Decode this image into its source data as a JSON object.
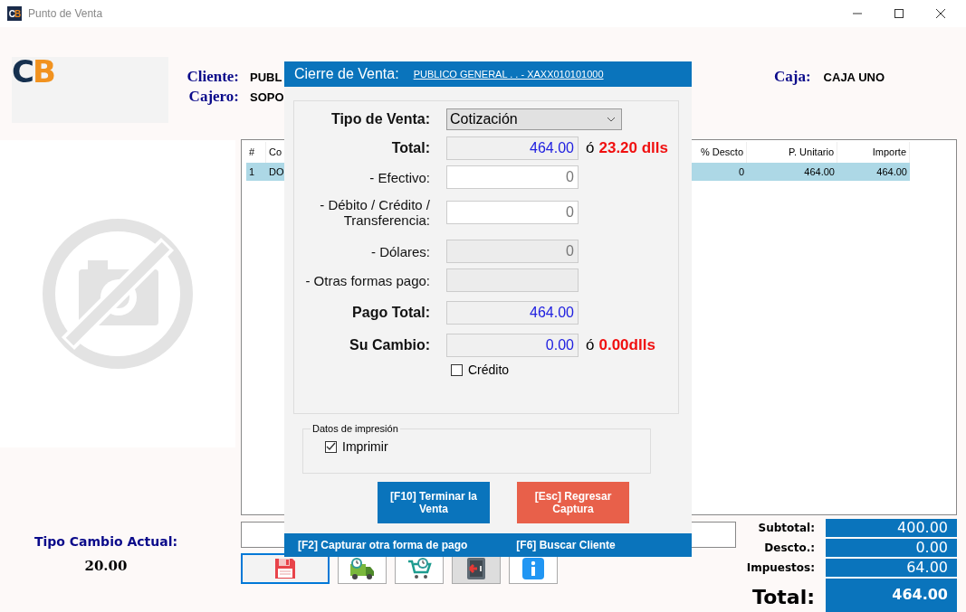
{
  "window": {
    "title": "Punto de Venta",
    "icon_letters": [
      "C",
      "B"
    ]
  },
  "logo": {
    "letters": [
      "C",
      "B"
    ]
  },
  "header": {
    "fields": [
      {
        "label": "Cliente:",
        "value": "PUBL"
      },
      {
        "label": "Cajero:",
        "value": "SOPO"
      }
    ],
    "caja": {
      "label": "Caja:",
      "value": "CAJA UNO"
    }
  },
  "table": {
    "columns": [
      "#",
      "Co",
      "% Descto",
      "P. Unitario",
      "Importe"
    ],
    "rows": [
      {
        "cells": [
          "1",
          "DO",
          "0",
          "464.00",
          "464.00"
        ],
        "selected": true
      }
    ]
  },
  "exchange": {
    "label": "Tipo Cambio Actual:",
    "value": "20.00"
  },
  "toolbar": [
    {
      "kind": "save",
      "selected": true
    },
    {
      "kind": "truck",
      "selected": false
    },
    {
      "kind": "cart",
      "selected": false
    },
    {
      "kind": "exit",
      "selected": false
    },
    {
      "kind": "info",
      "selected": false
    }
  ],
  "totals": [
    {
      "label": "Subtotal:",
      "value": "400.00",
      "kind": "line"
    },
    {
      "label": "Descto.:",
      "value": "0.00",
      "kind": "line"
    },
    {
      "label": "Impuestos:",
      "value": "64.00",
      "kind": "line"
    },
    {
      "label": "Total:",
      "value": "464.00",
      "kind": "grand"
    }
  ],
  "dialog": {
    "title": "Cierre de Venta:",
    "client_link": "PUBLICO GENERAL . . - XAXX010101000",
    "rows": [
      {
        "label": "Tipo de Venta:",
        "kind": "select",
        "value": "Cotización",
        "emphasis": true
      },
      {
        "label": "Total:",
        "kind": "computed",
        "value": "464.00",
        "emphasis": true,
        "prefix": "ó",
        "dollars": "23.20 dlls"
      },
      {
        "label": "- Efectivo:",
        "kind": "input",
        "value": "0",
        "emphasis": false
      },
      {
        "label": "- Débito / Crédito / Transferencia:",
        "kind": "input",
        "value": "0",
        "emphasis": false
      },
      {
        "label": "- Dólares:",
        "kind": "disabled",
        "value": "0",
        "emphasis": false
      },
      {
        "label": "- Otras formas pago:",
        "kind": "disabled",
        "emphasis": false
      },
      {
        "label": "Pago Total:",
        "kind": "computed",
        "value": "464.00",
        "emphasis": true
      },
      {
        "label": "Su Cambio:",
        "kind": "computed",
        "value": "0.00",
        "emphasis": true,
        "prefix": "ó",
        "dollars": "0.00dlls"
      }
    ],
    "credit": {
      "label": "Crédito",
      "checked": false
    },
    "print_group": {
      "title": "Datos de impresión",
      "checkbox": {
        "label": "Imprimir",
        "checked": true
      }
    },
    "buttons": [
      {
        "label": "[F10] Terminar la Venta",
        "kind": "primary"
      },
      {
        "label": "[Esc] Regresar Captura",
        "kind": "cancel"
      }
    ],
    "shortcuts": [
      "[F2] Capturar otra forma de pago",
      "[F6] Buscar Cliente"
    ]
  }
}
